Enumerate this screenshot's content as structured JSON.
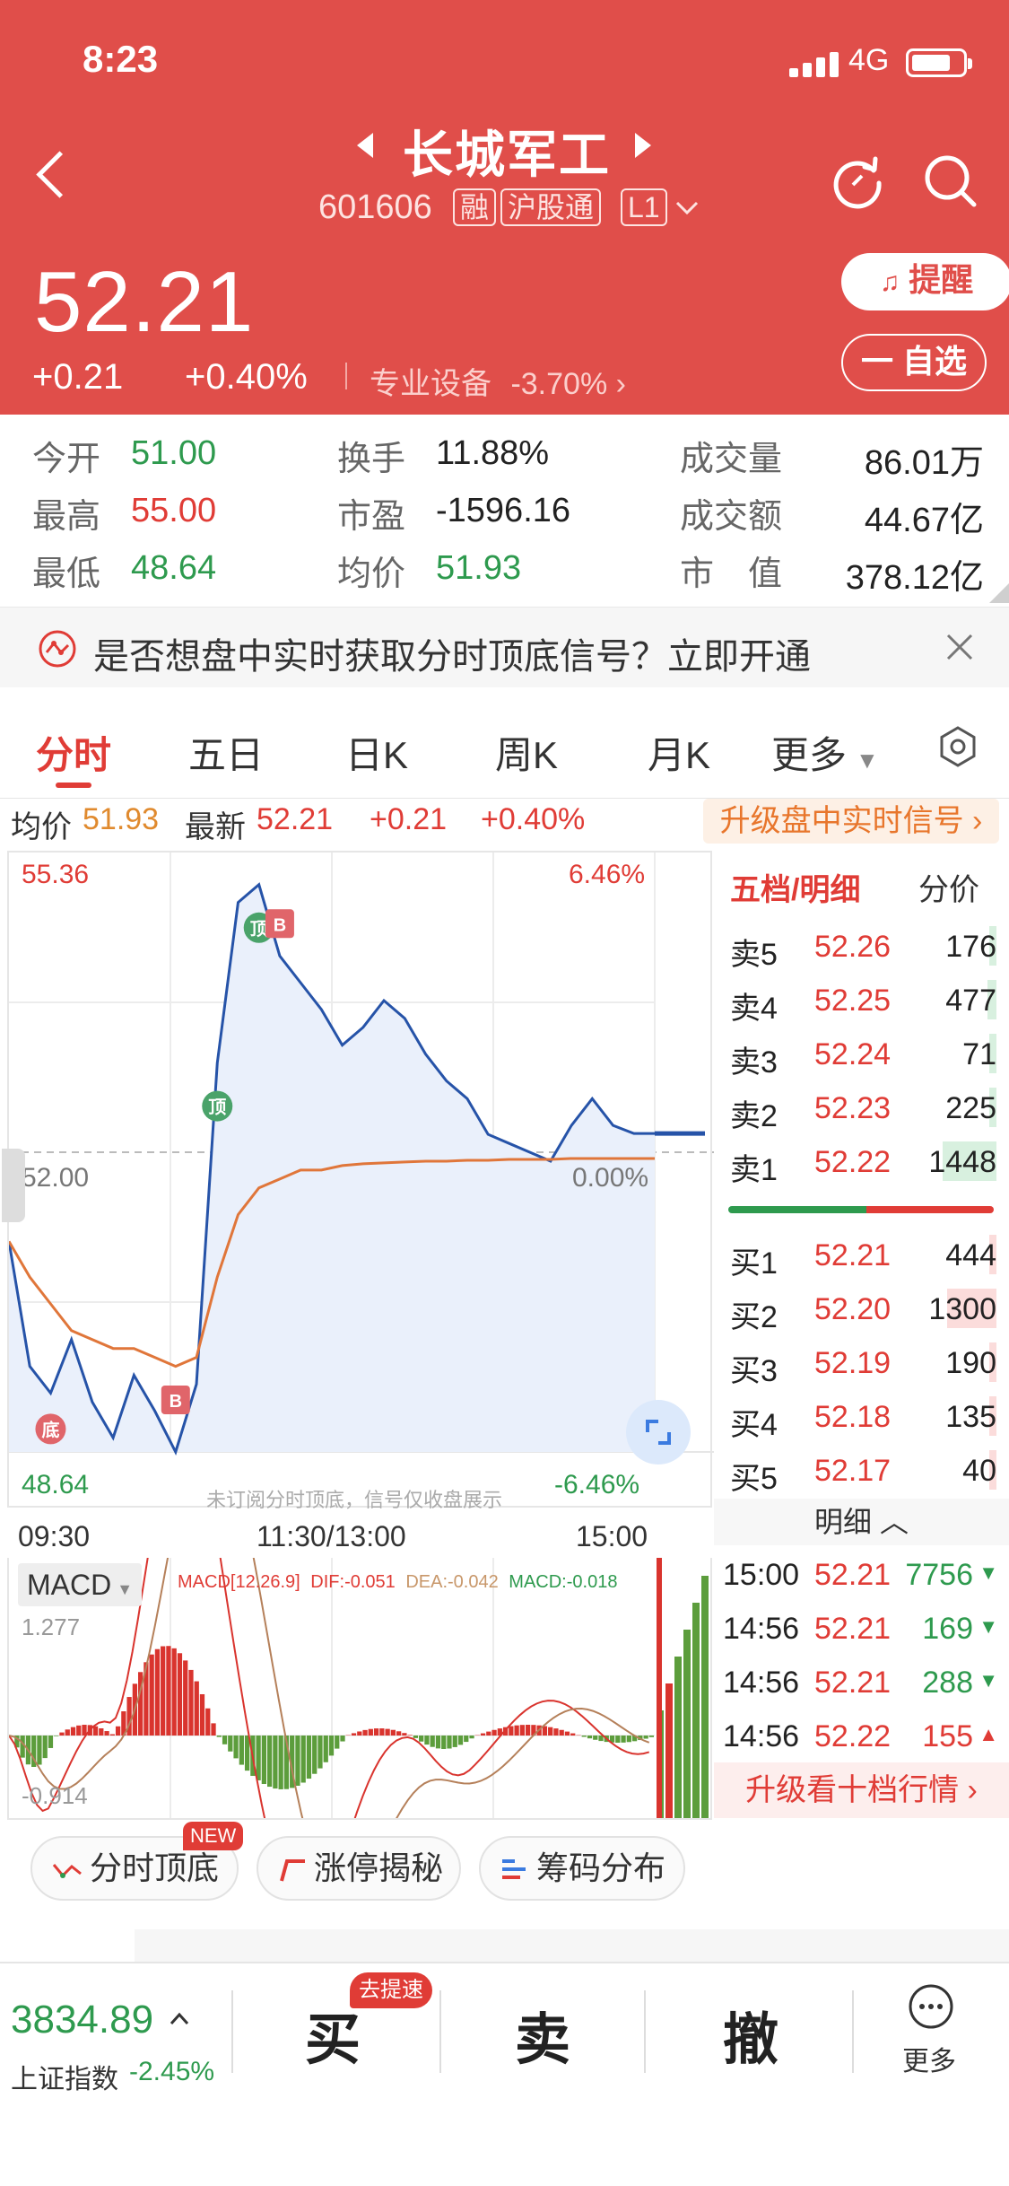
{
  "status_bar": {
    "time": "8:23",
    "network": "4G"
  },
  "header": {
    "stock_name": "长城军工",
    "code": "601606",
    "tags": [
      "融",
      "沪股通",
      "L1"
    ],
    "price": "52.21",
    "change": "+0.21",
    "change_pct": "+0.40%",
    "sector": "专业设备",
    "sector_pct": "-3.70%",
    "remind_label": "提醒",
    "fav_label": "一 自选"
  },
  "quote": {
    "open_label": "今开",
    "open": "51.00",
    "high_label": "最高",
    "high": "55.00",
    "low_label": "最低",
    "low": "48.64",
    "turnover_label": "换手",
    "turnover": "11.88%",
    "pe_label": "市盈",
    "pe": "-1596.16",
    "avg_label": "均价",
    "avg": "51.93",
    "vol_label": "成交量",
    "vol": "86.01万",
    "amount_label": "成交额",
    "amount": "44.67亿",
    "mcap_label": "市　值",
    "mcap": "378.12亿"
  },
  "banner": {
    "text": "是否想盘中实时获取分时顶底信号？立即开通"
  },
  "tabs": [
    {
      "label": "分时"
    },
    {
      "label": "五日"
    },
    {
      "label": "日K"
    },
    {
      "label": "周K"
    },
    {
      "label": "月K"
    },
    {
      "label": "更多"
    }
  ],
  "summary": {
    "avg_label": "均价",
    "avg": "51.93",
    "latest_label": "最新",
    "latest": "52.21",
    "chg": "+0.21",
    "pct": "+0.40%",
    "upgrade": "升级盘中实时信号"
  },
  "chart": {
    "top_price": "55.36",
    "top_pct": "6.46%",
    "mid_price": "52.00",
    "mid_pct": "0.00%",
    "bottom_price": "48.64",
    "bottom_pct": "-6.46%",
    "time_start": "09:30",
    "time_mid": "11:30/13:00",
    "time_end": "15:00",
    "watermark": "未订阅分时顶底，信号仅收盘展示",
    "markers": [
      "顶",
      "顶",
      "底",
      "B",
      "B"
    ]
  },
  "chart_data": {
    "type": "line",
    "series": [
      {
        "name": "最新",
        "values": [
          51.0,
          49.6,
          49.3,
          49.9,
          49.2,
          48.8,
          49.5,
          49.1,
          48.64,
          49.4,
          53.0,
          54.8,
          55.0,
          54.2,
          53.9,
          53.6,
          53.2,
          53.4,
          53.7,
          53.5,
          53.1,
          52.8,
          52.6,
          52.2,
          52.1,
          52.0,
          51.9,
          52.3,
          52.6,
          52.3,
          52.21,
          52.21
        ]
      },
      {
        "name": "均价",
        "values": [
          51.0,
          50.6,
          50.3,
          50.0,
          49.9,
          49.8,
          49.8,
          49.7,
          49.6,
          49.7,
          50.6,
          51.3,
          51.6,
          51.7,
          51.8,
          51.8,
          51.85,
          51.87,
          51.88,
          51.89,
          51.9,
          51.9,
          51.91,
          51.91,
          51.92,
          51.92,
          51.92,
          51.93,
          51.93,
          51.93,
          51.93,
          51.93
        ]
      }
    ],
    "ylim": [
      48.64,
      55.36
    ],
    "xticks": [
      "09:30",
      "11:30/13:00",
      "15:00"
    ]
  },
  "book": {
    "header": "五档/明细",
    "header_right": "分价",
    "asks": [
      {
        "label": "卖5",
        "price": "52.26",
        "vol": "176",
        "fill": 0.04
      },
      {
        "label": "卖4",
        "price": "52.25",
        "vol": "477",
        "fill": 0.1
      },
      {
        "label": "卖3",
        "price": "52.24",
        "vol": "71",
        "fill": 0.02
      },
      {
        "label": "卖2",
        "price": "52.23",
        "vol": "225",
        "fill": 0.05
      },
      {
        "label": "卖1",
        "price": "52.22",
        "vol": "1448",
        "fill": 0.6
      }
    ],
    "bids": [
      {
        "label": "买1",
        "price": "52.21",
        "vol": "444",
        "fill": 0.06
      },
      {
        "label": "买2",
        "price": "52.20",
        "vol": "1300",
        "fill": 0.55
      },
      {
        "label": "买3",
        "price": "52.19",
        "vol": "190",
        "fill": 0.03
      },
      {
        "label": "买4",
        "price": "52.18",
        "vol": "135",
        "fill": 0.02
      },
      {
        "label": "买5",
        "price": "52.17",
        "vol": "40",
        "fill": 0.01
      }
    ],
    "detail_label": "明细",
    "ticks": [
      {
        "time": "15:00",
        "price": "52.21",
        "vol": "7756",
        "dir": "down"
      },
      {
        "time": "14:56",
        "price": "52.21",
        "vol": "169",
        "dir": "down"
      },
      {
        "time": "14:56",
        "price": "52.21",
        "vol": "288",
        "dir": "down"
      },
      {
        "time": "14:56",
        "price": "52.22",
        "vol": "155",
        "dir": "up"
      }
    ],
    "upgrade": "升级看十档行情"
  },
  "macd": {
    "label": "MACD",
    "params": "MACD[12.26.9]",
    "dif": "DIF:-0.051",
    "dea": "DEA:-0.042",
    "macd": "MACD:-0.018",
    "top": "1.277",
    "bottom": "-0.914"
  },
  "tools": [
    {
      "label": "分时顶底",
      "badge": "NEW"
    },
    {
      "label": "涨停揭秘"
    },
    {
      "label": "筹码分布"
    }
  ],
  "bottom_bar": {
    "index_value": "3834.89",
    "index_name": "上证指数",
    "index_pct": "-2.45%",
    "buy": "买",
    "buy_badge": "去提速",
    "sell": "卖",
    "cancel": "撤",
    "more": "更多"
  }
}
